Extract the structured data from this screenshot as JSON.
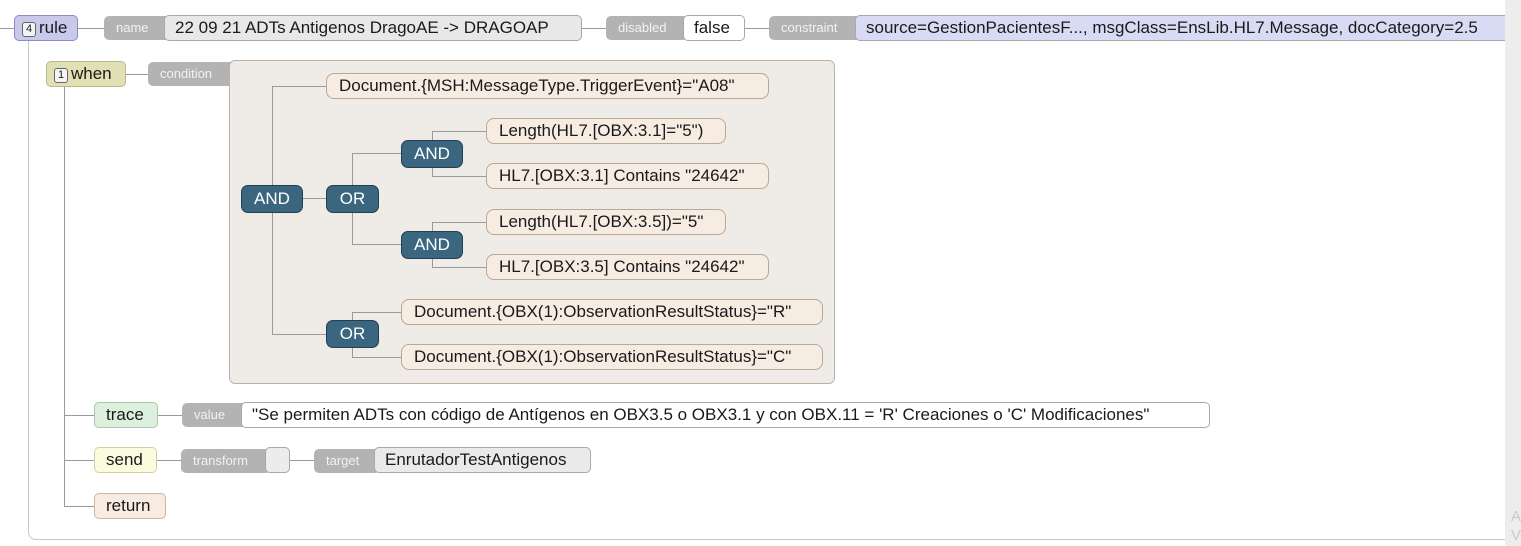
{
  "rule": {
    "badge": "4",
    "keyword": "rule",
    "name_label": "name",
    "name_value": "22 09 21 ADTs Antigenos DragoAE -> DRAGOAP",
    "disabled_label": "disabled",
    "disabled_value": "false",
    "constraint_label": "constraint",
    "constraint_value": "source=GestionPacientesF..., msgClass=EnsLib.HL7.Message, docCategory=2.5"
  },
  "when": {
    "badge": "1",
    "keyword": "when",
    "condition_label": "condition",
    "operators": {
      "and_root": "AND",
      "or_1": "OR",
      "and_1": "AND",
      "and_2": "AND",
      "or_2": "OR"
    },
    "conditions": {
      "c1": "Document.{MSH:MessageType.TriggerEvent}=\"A08\"",
      "c2": "Length(HL7.[OBX:3.1]=\"5\")",
      "c3": "HL7.[OBX:3.1] Contains \"24642\"",
      "c4": "Length(HL7.[OBX:3.5])=\"5\"",
      "c5": "HL7.[OBX:3.5] Contains \"24642\"",
      "c6": "Document.{OBX(1):ObservationResultStatus}=\"R\"",
      "c7": "Document.{OBX(1):ObservationResultStatus}=\"C\""
    }
  },
  "trace": {
    "keyword": "trace",
    "value_label": "value",
    "value": "\"Se permiten ADTs con código de Antígenos en OBX3.5 o OBX3.1 y con OBX.11 = 'R' Creaciones o 'C' Modificaciones\""
  },
  "send": {
    "keyword": "send",
    "transform_label": "transform",
    "transform_value": "",
    "target_label": "target",
    "target_value": "EnrutadorTestAntigenos"
  },
  "return": {
    "keyword": "return"
  },
  "watermark": [
    "A",
    "V"
  ],
  "colors": {
    "rule_bg": "#c9c9ec",
    "when_bg": "#e0e0b4",
    "trace_bg": "#ddefdd",
    "send_bg": "#fbfbe0",
    "return_bg": "#f8ebe1",
    "condition_panel": "#efebe6",
    "operator": "#3b6680"
  }
}
